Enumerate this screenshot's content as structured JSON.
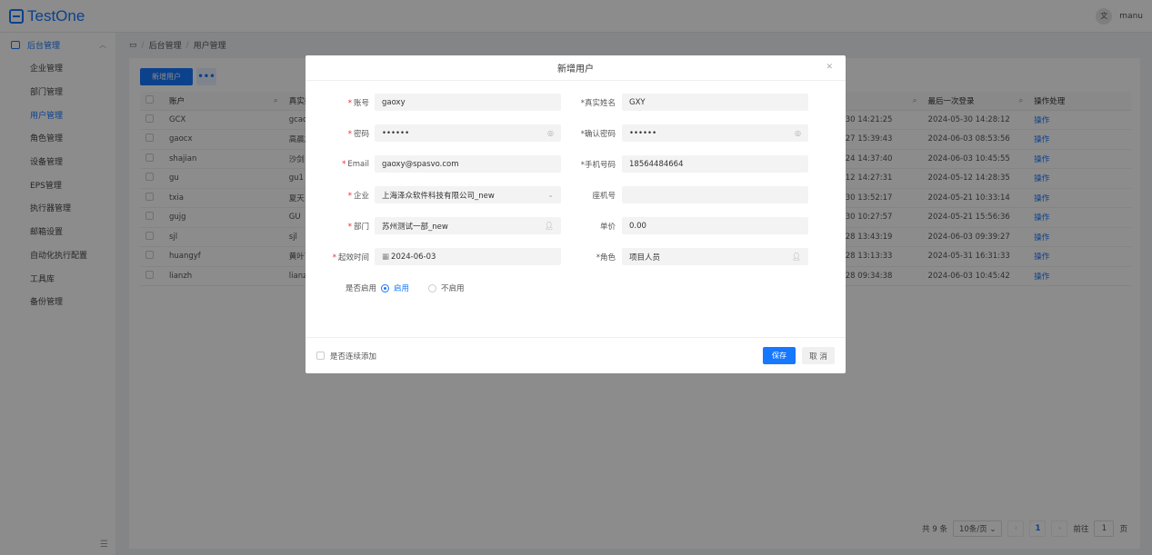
{
  "app": {
    "logo_text": "TestOne",
    "lang_icon": "translate-icon",
    "user": "manu"
  },
  "sidebar": {
    "group_label": "后台管理",
    "items": [
      {
        "label": "企业管理"
      },
      {
        "label": "部门管理"
      },
      {
        "label": "用户管理",
        "active": true
      },
      {
        "label": "角色管理"
      },
      {
        "label": "设备管理"
      },
      {
        "label": "EPS管理"
      },
      {
        "label": "执行器管理"
      },
      {
        "label": "邮箱设置"
      },
      {
        "label": "自动化执行配置"
      },
      {
        "label": "工具库"
      },
      {
        "label": "备份管理"
      }
    ]
  },
  "breadcrumb": {
    "root": "后台管理",
    "current": "用户管理"
  },
  "toolbar": {
    "add_label": "新增用户",
    "more_label": "•••"
  },
  "table": {
    "columns": [
      "账户",
      "真实姓",
      "",
      "最后一次登录",
      "操作处理"
    ],
    "rows": [
      {
        "account": "GCX",
        "name": "gcao",
        "created": "30 14:21:25",
        "last_login": "2024-05-30 14:28:12",
        "op": "操作"
      },
      {
        "account": "gaocx",
        "name": "高晨旭",
        "created": "27 15:39:43",
        "last_login": "2024-06-03 08:53:56",
        "op": "操作"
      },
      {
        "account": "shajian",
        "name": "沙剑",
        "created": "24 14:37:40",
        "last_login": "2024-06-03 10:45:55",
        "op": "操作"
      },
      {
        "account": "gu",
        "name": "gu1",
        "created": "12 14:27:31",
        "last_login": "2024-05-12 14:28:35",
        "op": "操作"
      },
      {
        "account": "txia",
        "name": "夏天",
        "created": "30 13:52:17",
        "last_login": "2024-05-21 10:33:14",
        "op": "操作"
      },
      {
        "account": "gujg",
        "name": "GU",
        "created": "30 10:27:57",
        "last_login": "2024-05-21 15:56:36",
        "op": "操作"
      },
      {
        "account": "sjl",
        "name": "sjl",
        "created": "28 13:43:19",
        "last_login": "2024-06-03 09:39:27",
        "op": "操作"
      },
      {
        "account": "huangyf",
        "name": "黄叶飞",
        "created": "28 13:13:33",
        "last_login": "2024-05-31 16:31:33",
        "op": "操作"
      },
      {
        "account": "lianzh",
        "name": "lianzh",
        "created": "28 09:34:38",
        "last_login": "2024-06-03 10:45:42",
        "op": "操作"
      }
    ]
  },
  "pager": {
    "total": "共 9 条",
    "page_size": "10条/页",
    "current": "1",
    "jump_label": "前往",
    "jump_value": "1",
    "page_unit": "页"
  },
  "modal": {
    "title": "新增用户",
    "fields": {
      "account": {
        "label": "账号",
        "value": "gaoxy"
      },
      "realname": {
        "label": "真实姓名",
        "value": "GXY"
      },
      "password": {
        "label": "密码",
        "value": "••••••"
      },
      "confirm": {
        "label": "确认密码",
        "value": "••••••"
      },
      "email": {
        "label": "Email",
        "value": "gaoxy@spasvo.com"
      },
      "phone": {
        "label": "手机号码",
        "value": "18564484664"
      },
      "company": {
        "label": "企业",
        "value": "上海泽众软件科技有限公司_new"
      },
      "landline": {
        "label": "座机号",
        "value": ""
      },
      "dept": {
        "label": "部门",
        "value": "苏州测试一部_new"
      },
      "price": {
        "label": "单价",
        "value": "0.00"
      },
      "start": {
        "label": "起效时间",
        "value": "2024-06-03"
      },
      "role": {
        "label": "角色",
        "value": "项目人员"
      }
    },
    "enable": {
      "label": "是否启用",
      "on": "启用",
      "off": "不启用"
    },
    "continue_label": "是否连续添加",
    "save_label": "保存",
    "cancel_label": "取 消"
  }
}
